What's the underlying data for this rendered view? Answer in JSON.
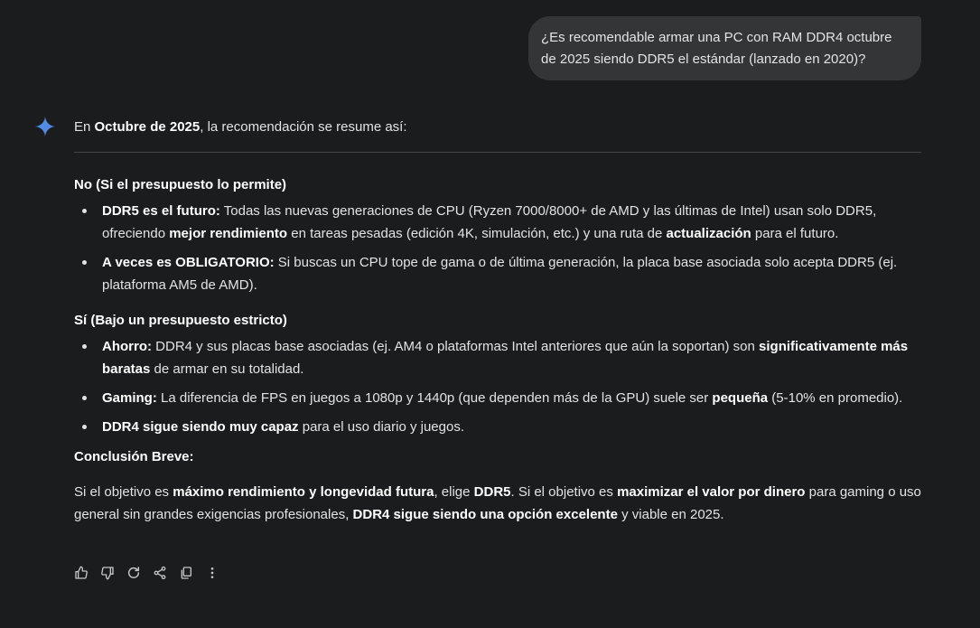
{
  "user_message": "¿Es recomendable armar una PC con RAM DDR4 octubre de 2025 siendo DDR5 el estándar (lanzado en 2020)?",
  "response": {
    "intro": {
      "pre": "En ",
      "bold": "Octubre de 2025",
      "post": ", la recomendación se resume así:"
    },
    "section_no": {
      "heading": "No (Si el presupuesto lo permite)",
      "items": [
        {
          "label": "DDR5 es el futuro:",
          "t1": " Todas las nuevas generaciones de CPU (Ryzen 7000/8000+ de AMD y las últimas de Intel) usan solo DDR5, ofreciendo ",
          "b1": "mejor rendimiento",
          "t2": " en tareas pesadas (edición 4K, simulación, etc.) y una ruta de ",
          "b2": "actualización",
          "t3": " para el futuro."
        },
        {
          "label": "A veces es OBLIGATORIO:",
          "t1": " Si buscas un CPU tope de gama o de última generación, la placa base asociada solo acepta DDR5 (ej. plataforma AM5 de AMD)."
        }
      ]
    },
    "section_si": {
      "heading": "Sí (Bajo un presupuesto estricto)",
      "items": [
        {
          "label": "Ahorro:",
          "t1": " DDR4 y sus placas base asociadas (ej. AM4 o plataformas Intel anteriores que aún la soportan) son ",
          "b1": "significativamente más baratas",
          "t2": " de armar en su totalidad."
        },
        {
          "label": "Gaming:",
          "t1": " La diferencia de FPS en juegos a 1080p y 1440p (que dependen más de la GPU) suele ser ",
          "b1": "pequeña",
          "t2": " (5-10% en promedio)."
        },
        {
          "label": "DDR4 sigue siendo muy capaz",
          "t1": " para el uso diario y juegos."
        }
      ]
    },
    "conclusion": {
      "heading": "Conclusión Breve:",
      "t1": "Si el objetivo es ",
      "b1": "máximo rendimiento y longevidad futura",
      "t2": ", elige ",
      "b2": "DDR5",
      "t3": ". Si el objetivo es ",
      "b3": "maximizar el valor por dinero",
      "t4": " para gaming o uso general sin grandes exigencias profesionales, ",
      "b4": "DDR4 sigue siendo una opción excelente",
      "t5": " y viable en 2025."
    }
  },
  "actions": [
    {
      "name": "thumbs-up-icon",
      "title": "Good response"
    },
    {
      "name": "thumbs-down-icon",
      "title": "Bad response"
    },
    {
      "name": "regenerate-icon",
      "title": "Redo"
    },
    {
      "name": "share-icon",
      "title": "Share"
    },
    {
      "name": "copy-icon",
      "title": "Copy"
    },
    {
      "name": "more-options-icon",
      "title": "More"
    }
  ],
  "colors": {
    "background": "#1b1c1d",
    "user_bubble": "#333537",
    "text": "#e3e3e3",
    "bold_text": "#ffffff",
    "divider": "#444746",
    "spark_blue": "#4796e3"
  }
}
